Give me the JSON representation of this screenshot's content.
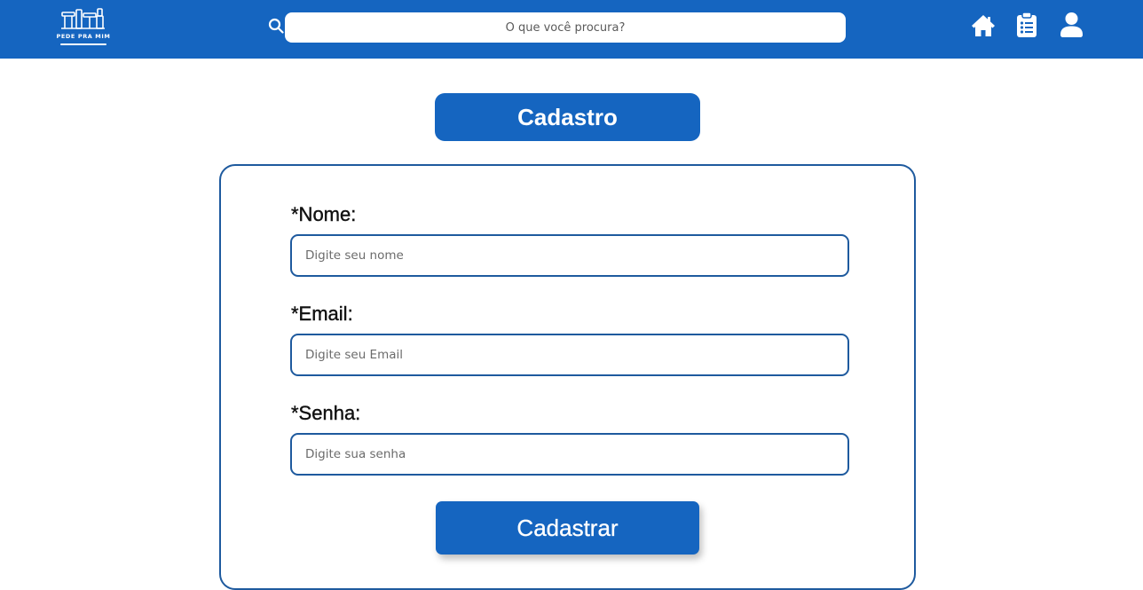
{
  "header": {
    "logo_text": "PEDE PRA MIM",
    "search": {
      "placeholder": "O que você procura?"
    },
    "icons": [
      "home-icon",
      "clipboard-list-icon",
      "user-icon"
    ]
  },
  "page": {
    "title": "Cadastro"
  },
  "form": {
    "fields": [
      {
        "label": "*Nome:",
        "placeholder": "Digite seu nome"
      },
      {
        "label": "*Email:",
        "placeholder": "Digite seu Email"
      },
      {
        "label": "*Senha:",
        "placeholder": "Digite sua senha"
      }
    ],
    "submit_label": "Cadastrar"
  },
  "colors": {
    "brand": "#1565c0",
    "border": "#1e5a9e",
    "background": "#ffffff"
  }
}
